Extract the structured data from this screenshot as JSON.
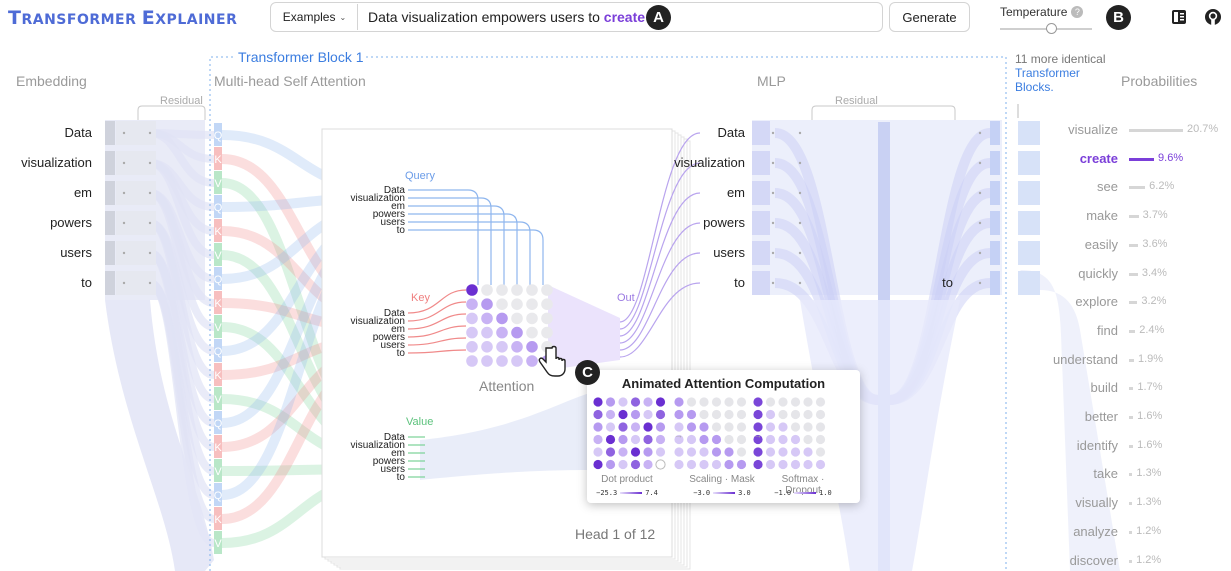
{
  "header": {
    "app_title_first": "T",
    "app_title_rest1": "RANSFORMER ",
    "app_title_mid": "E",
    "app_title_rest2": "XPLAINER",
    "examples_label": "Examples",
    "prompt_text": "Data visualization empowers users to",
    "prompt_highlight": "create",
    "generate_label": "Generate",
    "temperature_label": "Temperature",
    "help_glyph": "?",
    "temperature_value": 0.55,
    "badge_a": "A",
    "badge_b": "B",
    "badge_c": "C",
    "icons": [
      "chevron-down-icon",
      "help-icon",
      "book-icon",
      "github-icon"
    ]
  },
  "sections": {
    "embedding": "Embedding",
    "block_title": "Transformer Block 1",
    "mhsa": "Multi-head Self Attention",
    "mlp": "MLP",
    "residual": "Residual",
    "more_line1": "11 more identical",
    "more_line2": "Transformer",
    "more_line3": "Blocks.",
    "probabilities": "Probabilities"
  },
  "tokens": [
    "Data",
    "visualization",
    "em",
    "powers",
    "users",
    "to"
  ],
  "mlp_tokens": [
    "Data",
    "visualization",
    "em",
    "powers",
    "users",
    "to"
  ],
  "last_token": "to",
  "qkv_letters": [
    "Q",
    "K",
    "V"
  ],
  "attention": {
    "query_label": "Query",
    "key_label": "Key",
    "value_label": "Value",
    "out_label": "Out",
    "attention_label": "Attention",
    "head_label": "Head 1 of 12"
  },
  "popup": {
    "title": "Animated Attention Computation",
    "steps": [
      {
        "caption": "Dot product",
        "min": "−25.3",
        "max": "7.4"
      },
      {
        "caption": "Scaling · Mask",
        "min": "−3.0",
        "max": "3.0"
      },
      {
        "caption": "Softmax · Dropout",
        "min": "−1.0",
        "max": "1.0"
      }
    ]
  },
  "probabilities": [
    {
      "word": "visualize",
      "pct": "20.7%",
      "value": 20.7
    },
    {
      "word": "create",
      "pct": "9.6%",
      "value": 9.6,
      "selected": true
    },
    {
      "word": "see",
      "pct": "6.2%",
      "value": 6.2
    },
    {
      "word": "make",
      "pct": "3.7%",
      "value": 3.7
    },
    {
      "word": "easily",
      "pct": "3.6%",
      "value": 3.6
    },
    {
      "word": "quickly",
      "pct": "3.4%",
      "value": 3.4
    },
    {
      "word": "explore",
      "pct": "3.2%",
      "value": 3.2
    },
    {
      "word": "find",
      "pct": "2.4%",
      "value": 2.4
    },
    {
      "word": "understand",
      "pct": "1.9%",
      "value": 1.9
    },
    {
      "word": "build",
      "pct": "1.7%",
      "value": 1.7
    },
    {
      "word": "better",
      "pct": "1.6%",
      "value": 1.6
    },
    {
      "word": "identify",
      "pct": "1.6%",
      "value": 1.6
    },
    {
      "word": "take",
      "pct": "1.3%",
      "value": 1.3
    },
    {
      "word": "visually",
      "pct": "1.3%",
      "value": 1.3
    },
    {
      "word": "analyze",
      "pct": "1.2%",
      "value": 1.2
    },
    {
      "word": "discover",
      "pct": "1.2%",
      "value": 1.2
    }
  ],
  "colors": {
    "brand": "#4e6bd6",
    "accent": "#7b3fd9",
    "block": "#3b7de0",
    "query": "#8fb6ee",
    "key": "#f08a8a",
    "value": "#7fd49a",
    "mlp": "#c9cdf5"
  }
}
